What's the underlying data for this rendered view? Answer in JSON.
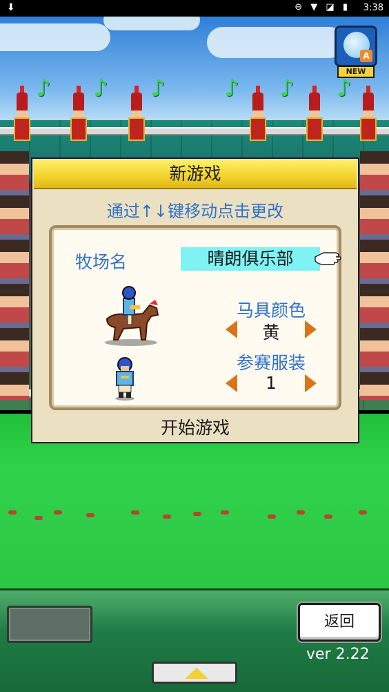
{
  "status_bar": {
    "download_icon": "download-icon",
    "icons": [
      "minus-circle-icon",
      "wifi-icon",
      "no-signal-icon",
      "battery-icon"
    ],
    "time": "3:38"
  },
  "badge": {
    "label": "NEW",
    "letter": "A"
  },
  "dialog": {
    "title": "新游戏",
    "hint": "通过↑↓键移动点击更改",
    "farm_name_label": "牧场名",
    "farm_name_value": "晴朗俱乐部",
    "saddle_color_label": "马具颜色",
    "saddle_color_value": "黄",
    "outfit_label": "参赛服装",
    "outfit_value": "1",
    "start_label": "开始游戏"
  },
  "bottom_bar": {
    "back_label": "返回",
    "version": "ver 2.22"
  },
  "colors": {
    "title_yellow": "#f1d22a",
    "label_blue": "#2f73c8",
    "highlight_cyan": "#7ff3f4",
    "arrow_orange": "#d9741b",
    "grass_green": "#2cc744"
  }
}
